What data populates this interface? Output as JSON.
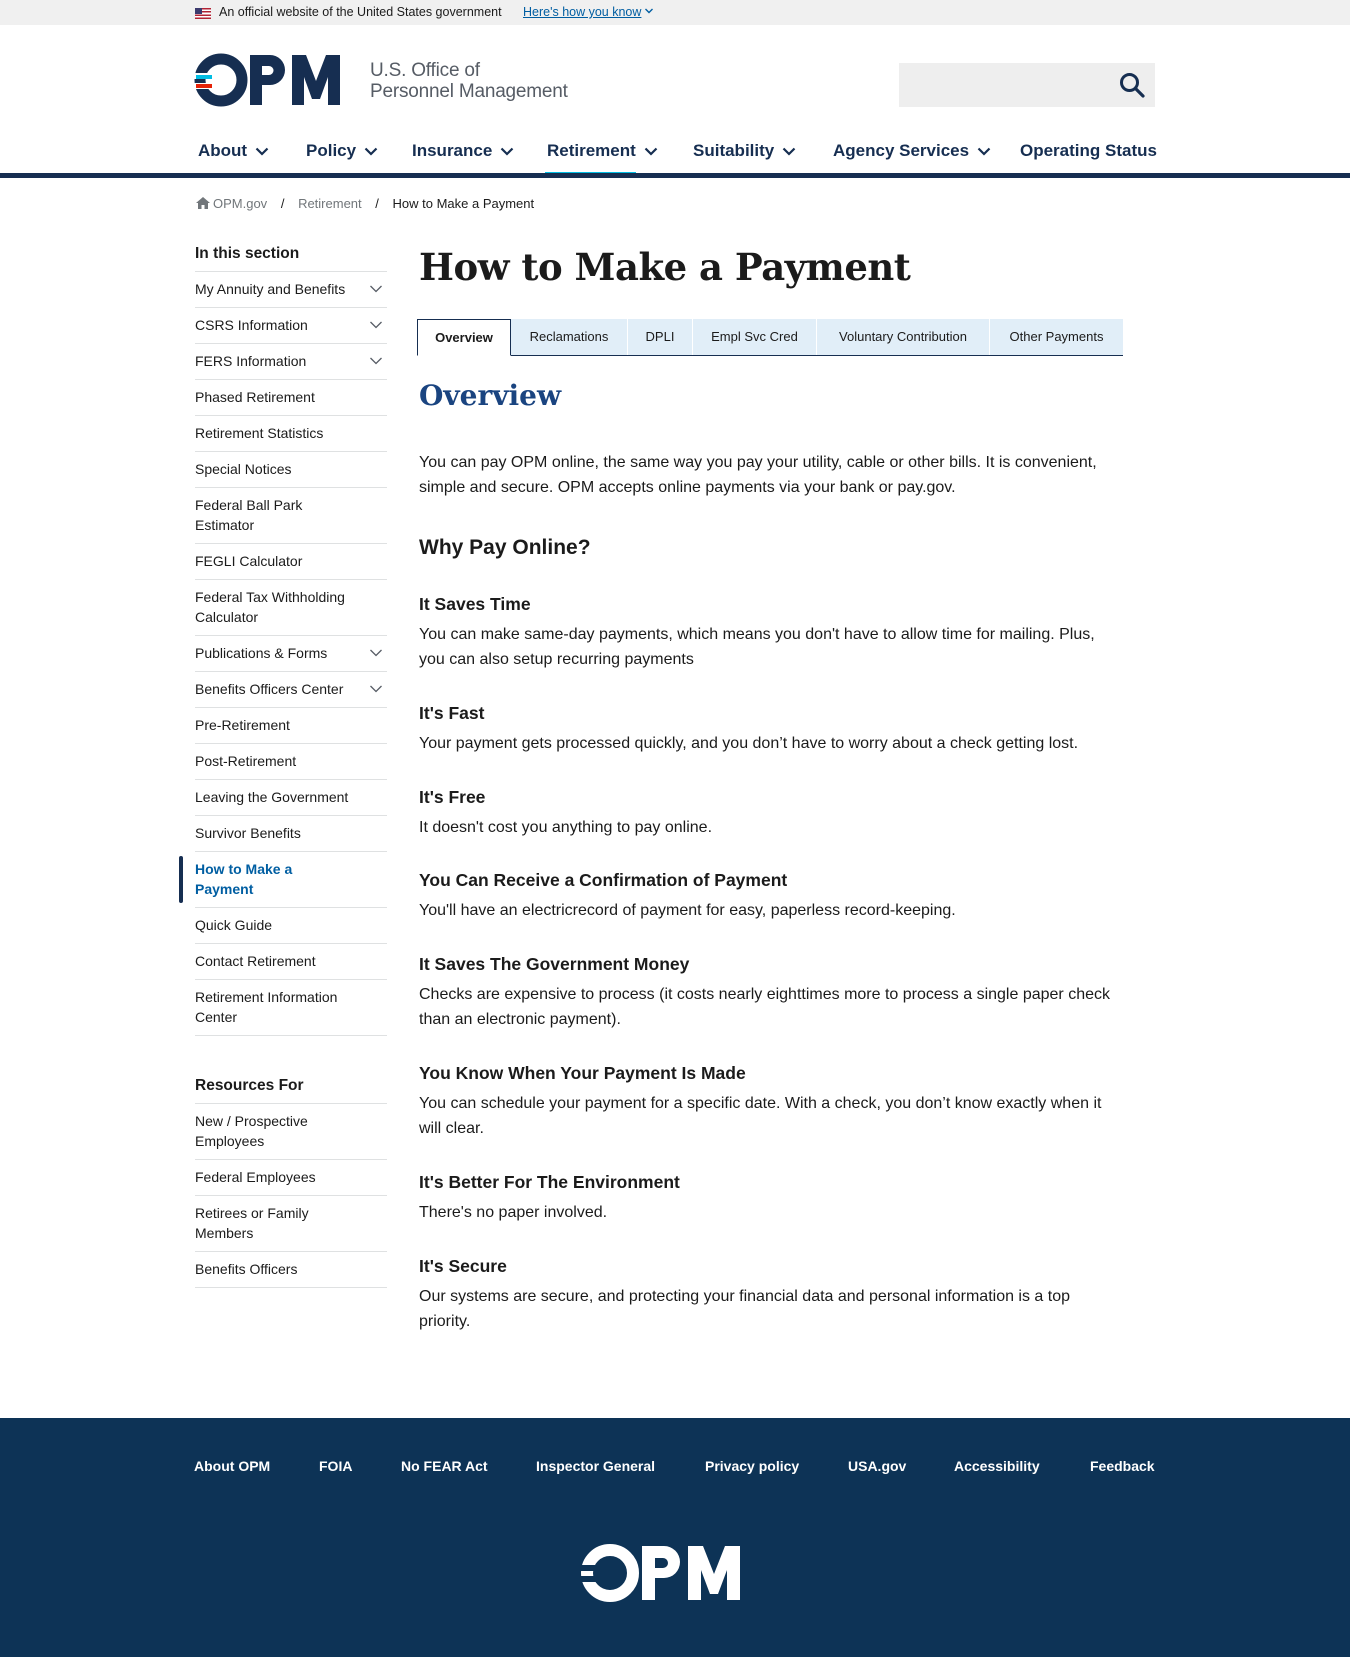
{
  "gov_banner": {
    "text": "An official website of the United States government",
    "link": "Here's how you know"
  },
  "header": {
    "logo_text": "OPM",
    "logo_sub_line1": "U.S. Office of",
    "logo_sub_line2": "Personnel Management",
    "search_placeholder": ""
  },
  "nav": {
    "items": [
      {
        "label": "About",
        "has_dropdown": true
      },
      {
        "label": "Policy",
        "has_dropdown": true
      },
      {
        "label": "Insurance",
        "has_dropdown": true
      },
      {
        "label": "Retirement",
        "has_dropdown": true,
        "active": true
      },
      {
        "label": "Suitability",
        "has_dropdown": true
      },
      {
        "label": "Agency Services",
        "has_dropdown": true
      },
      {
        "label": "Operating Status",
        "has_dropdown": false
      }
    ]
  },
  "breadcrumb": {
    "home": "OPM.gov",
    "parent": "Retirement",
    "current": "How to Make a Payment",
    "separator": "/"
  },
  "sidenav": {
    "heading": "In this section",
    "items": [
      {
        "label": "My Annuity and Benefits",
        "expandable": true
      },
      {
        "label": "CSRS Information",
        "expandable": true
      },
      {
        "label": "FERS Information",
        "expandable": true
      },
      {
        "label": "Phased Retirement",
        "expandable": false
      },
      {
        "label": "Retirement Statistics",
        "expandable": false
      },
      {
        "label": "Special Notices",
        "expandable": false
      },
      {
        "label": "Federal Ball Park Estimator",
        "expandable": false
      },
      {
        "label": "FEGLI Calculator",
        "expandable": false
      },
      {
        "label": "Federal Tax Withholding Calculator",
        "expandable": false
      },
      {
        "label": "Publications & Forms",
        "expandable": true
      },
      {
        "label": "Benefits Officers Center",
        "expandable": true
      },
      {
        "label": "Pre-Retirement",
        "expandable": false
      },
      {
        "label": "Post-Retirement",
        "expandable": false
      },
      {
        "label": "Leaving the Government",
        "expandable": false
      },
      {
        "label": "Survivor Benefits",
        "expandable": false
      },
      {
        "label": "How to Make a Payment",
        "expandable": false,
        "current": true
      },
      {
        "label": "Quick Guide",
        "expandable": false
      },
      {
        "label": "Contact Retirement",
        "expandable": false
      },
      {
        "label": "Retirement Information Center",
        "expandable": false
      }
    ]
  },
  "resources": {
    "heading": "Resources For",
    "items": [
      {
        "label": "New / Prospective Employees"
      },
      {
        "label": "Federal Employees"
      },
      {
        "label": "Retirees or Family Members"
      },
      {
        "label": "Benefits Officers"
      }
    ]
  },
  "main": {
    "title": "How to Make a Payment",
    "tabs": [
      {
        "label": "Overview",
        "active": true
      },
      {
        "label": "Reclamations"
      },
      {
        "label": "DPLI"
      },
      {
        "label": "Empl Svc Cred"
      },
      {
        "label": "Voluntary Contribution"
      },
      {
        "label": "Other Payments"
      }
    ],
    "overview_heading": "Overview",
    "intro": "You can pay OPM online, the same way you pay your utility, cable or other bills. It is convenient, simple and secure. OPM accepts online payments via your bank or pay.gov.",
    "why_heading": "Why Pay Online?",
    "reasons": [
      {
        "heading": "It Saves Time",
        "text": "You can make same-day payments, which means you don't have to allow time for mailing. Plus, you can also setup recurring payments"
      },
      {
        "heading": "It's Fast",
        "text": "Your payment gets processed quickly, and you don’t have to worry about a check getting lost."
      },
      {
        "heading": "It's Free",
        "text": "It doesn't cost you anything to pay online."
      },
      {
        "heading": "You Can Receive a Confirmation of Payment",
        "text": "You'll have an electricrecord of payment for easy, paperless record-keeping."
      },
      {
        "heading": "It Saves The Government Money",
        "text": "Checks are expensive to process (it costs nearly eighttimes more to process a single paper check than an electronic payment)."
      },
      {
        "heading": "You Know When Your Payment Is Made",
        "text": "You can schedule your payment for a specific date. With a check, you don’t know exactly when it will clear."
      },
      {
        "heading": "It's Better For The Environment",
        "text": "There's no paper involved."
      },
      {
        "heading": "It's Secure",
        "text": "Our systems are secure, and protecting your financial data and personal information is a top priority."
      }
    ]
  },
  "footer": {
    "links": [
      "About OPM",
      "FOIA",
      "No FEAR Act",
      "Inspector General",
      "Privacy policy",
      "USA.gov",
      "Accessibility",
      "Feedback"
    ],
    "logo_text": "OPM"
  },
  "colors": {
    "navy": "#162e51",
    "accent_cyan": "#00bde3",
    "link_blue": "#005ea2",
    "heading_blue": "#1a4480",
    "footer_bg": "#0d3356",
    "logo_red": "#e52207",
    "tab_bg": "#e1eef8"
  }
}
